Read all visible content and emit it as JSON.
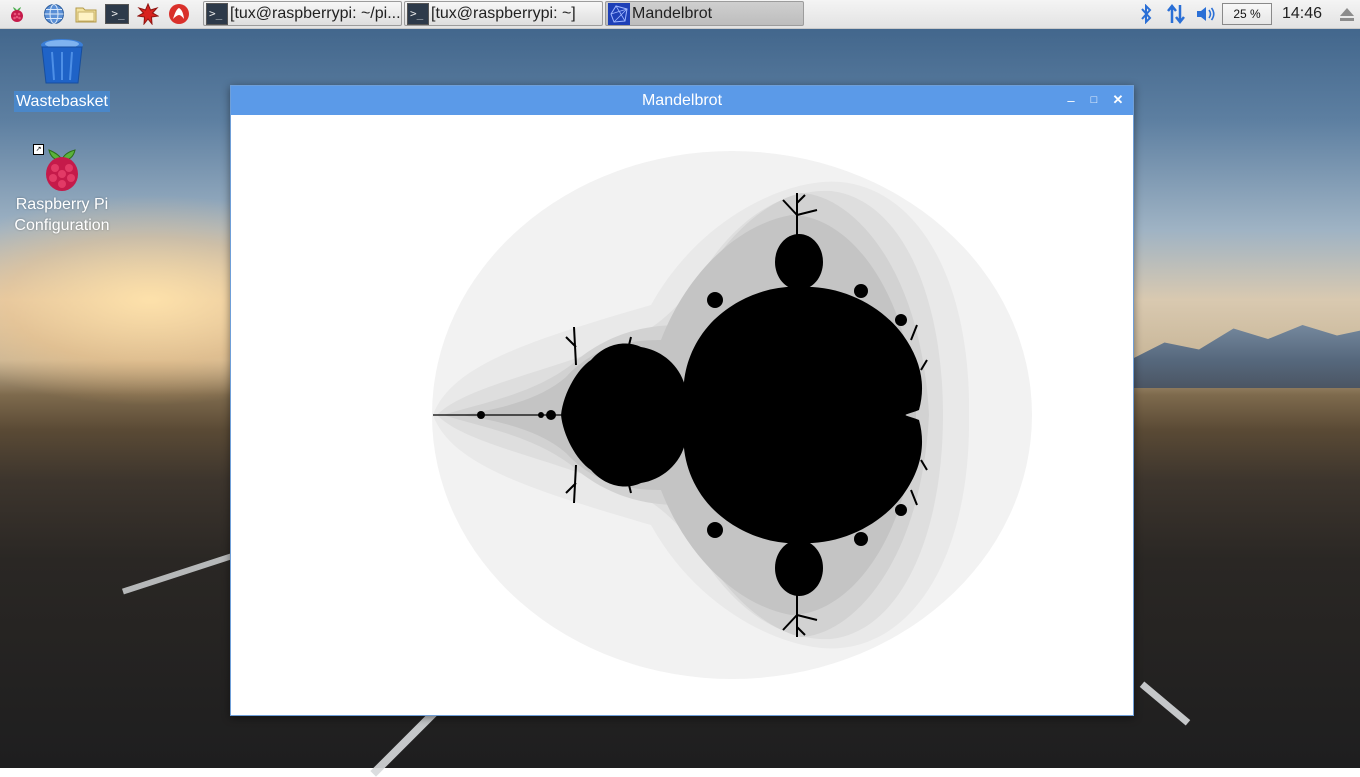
{
  "taskbar": {
    "launchers": [
      "raspberry-menu-icon",
      "web-browser-icon",
      "file-manager-icon",
      "terminal-icon",
      "mathematica-icon",
      "wolfram-icon"
    ],
    "tasks": [
      {
        "label": "[tux@raspberrypi: ~/pi...",
        "icon": "terminal-icon",
        "active": false
      },
      {
        "label": "[tux@raspberrypi: ~]",
        "icon": "terminal-icon",
        "active": false
      },
      {
        "label": "Mandelbrot",
        "icon": "mandelbrot-app-icon",
        "active": true
      }
    ],
    "cpu_usage": "25 %",
    "clock": "14:46"
  },
  "desktop": {
    "icons": [
      {
        "label": "Wastebasket",
        "selected": true
      },
      {
        "label": "Raspberry Pi Configuration",
        "line1": "Raspberry Pi",
        "line2": "Configuration"
      }
    ]
  },
  "window": {
    "title": "Mandelbrot",
    "minimize_glyph": "–",
    "maximize_glyph": "□",
    "close_glyph": "✕",
    "fractal": {
      "colors": {
        "set": "#000000",
        "band1": "#f2f2f2",
        "band2": "#e9e9e9",
        "band3": "#dedede",
        "band4": "#d2d2d2",
        "band5": "#c4c4c4",
        "background": "#ffffff"
      }
    }
  },
  "colors": {
    "titlebar": "#5b9ae8",
    "taskbar": "#e9e9e9",
    "selection": "#4a87c9"
  }
}
